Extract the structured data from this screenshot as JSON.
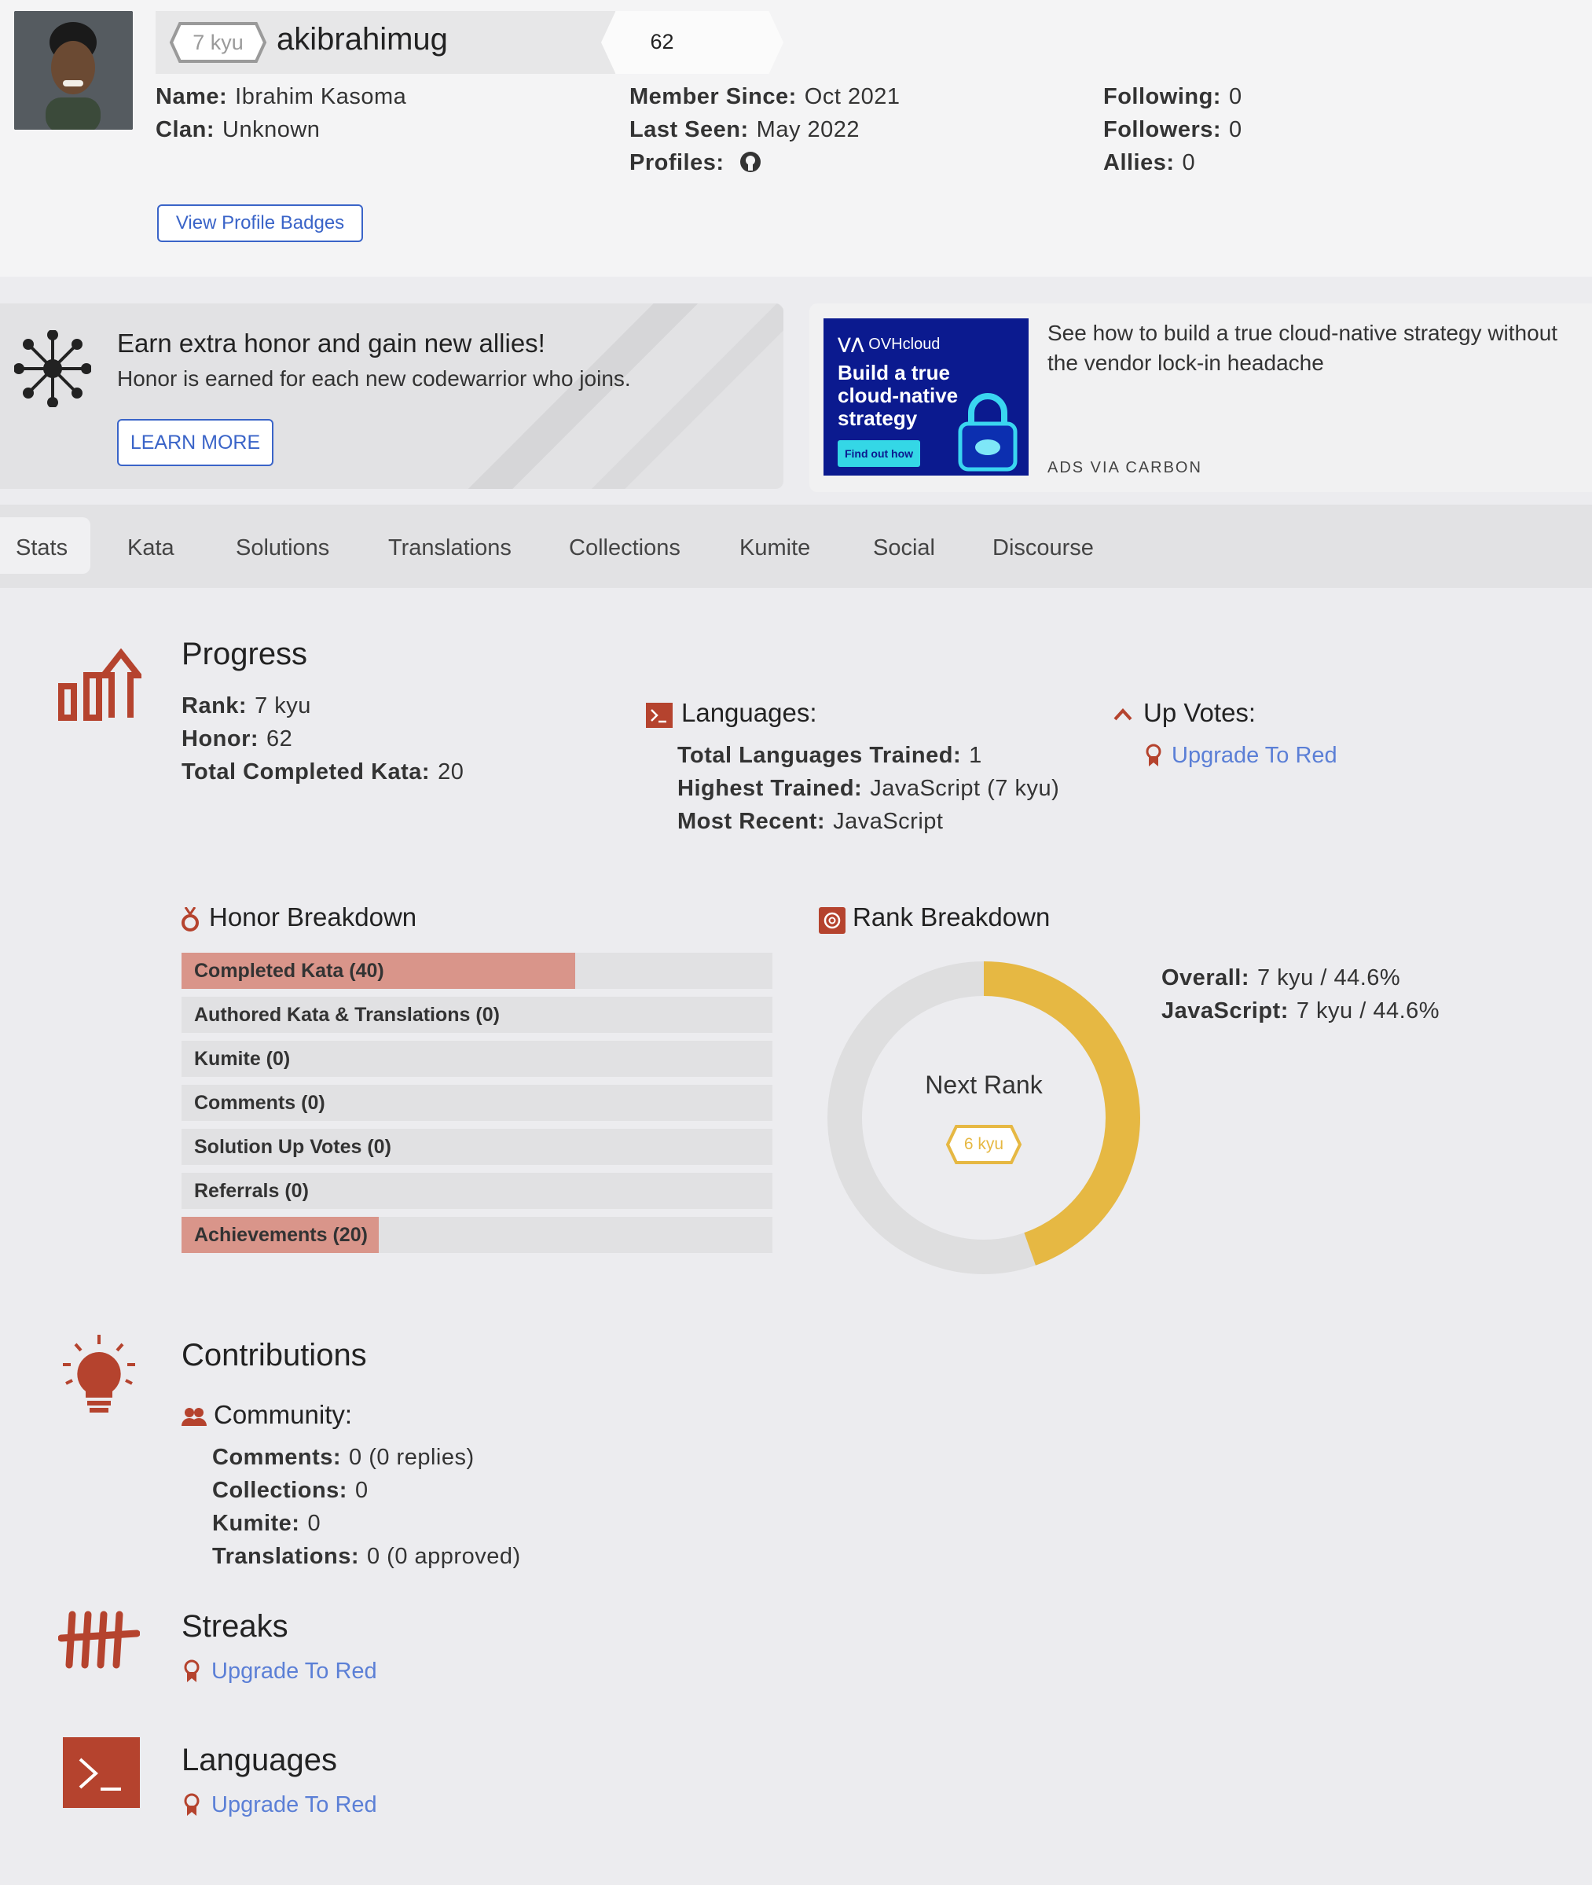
{
  "profile": {
    "rank": "7 kyu",
    "username": "akibrahimug",
    "honor": "62",
    "name_label": "Name:",
    "name": "Ibrahim Kasoma",
    "clan_label": "Clan:",
    "clan": "Unknown",
    "member_since_label": "Member Since:",
    "member_since": "Oct 2021",
    "last_seen_label": "Last Seen:",
    "last_seen": "May 2022",
    "profiles_label": "Profiles:",
    "following_label": "Following:",
    "following": "0",
    "followers_label": "Followers:",
    "followers": "0",
    "allies_label": "Allies:",
    "allies": "0",
    "badges_button": "View Profile Badges"
  },
  "promo": {
    "title": "Earn extra honor and gain new allies!",
    "subtitle": "Honor is earned for each new codewarrior who joins.",
    "button": "LEARN MORE"
  },
  "ad": {
    "brand": "OVHcloud",
    "headline_lines": [
      "Build a true",
      "cloud-native",
      "strategy"
    ],
    "cta": "Find out how",
    "text": "See how to build a true cloud-native strategy without the vendor lock-in headache",
    "footer": "ADS VIA CARBON"
  },
  "tabs": [
    "Stats",
    "Kata",
    "Solutions",
    "Translations",
    "Collections",
    "Kumite",
    "Social",
    "Discourse"
  ],
  "progress": {
    "title": "Progress",
    "rank_label": "Rank:",
    "rank": "7 kyu",
    "honor_label": "Honor:",
    "honor": "62",
    "completed_label": "Total Completed Kata:",
    "completed": "20",
    "languages_title": "Languages:",
    "total_lang_label": "Total Languages Trained:",
    "total_lang": "1",
    "highest_label": "Highest Trained:",
    "highest": "JavaScript (7 kyu)",
    "recent_label": "Most Recent:",
    "recent": "JavaScript",
    "upvotes_title": "Up Votes:",
    "upgrade": "Upgrade To Red"
  },
  "honor_breakdown": {
    "title": "Honor Breakdown",
    "items": [
      {
        "label": "Completed Kata (40)",
        "value": 40
      },
      {
        "label": "Authored Kata & Translations (0)",
        "value": 0
      },
      {
        "label": "Kumite (0)",
        "value": 0
      },
      {
        "label": "Comments (0)",
        "value": 0
      },
      {
        "label": "Solution Up Votes (0)",
        "value": 0
      },
      {
        "label": "Referrals (0)",
        "value": 0
      },
      {
        "label": "Achievements (20)",
        "value": 20
      }
    ],
    "bar_max": 60
  },
  "rank_breakdown": {
    "title": "Rank Breakdown",
    "center_label": "Next Rank",
    "next_rank": "6 kyu",
    "progress_fraction": 0.446,
    "overall_label": "Overall:",
    "overall": "7 kyu / 44.6%",
    "js_label": "JavaScript:",
    "js": "7 kyu / 44.6%",
    "colors": {
      "fill": "#e6b843",
      "track": "#dededf"
    }
  },
  "contributions": {
    "title": "Contributions",
    "community_title": "Community:",
    "comments_label": "Comments:",
    "comments": "0 (0 replies)",
    "collections_label": "Collections:",
    "collections": "0",
    "kumite_label": "Kumite:",
    "kumite": "0",
    "translations_label": "Translations:",
    "translations": "0 (0 approved)"
  },
  "streaks": {
    "title": "Streaks",
    "upgrade": "Upgrade To Red"
  },
  "languages": {
    "title": "Languages",
    "upgrade": "Upgrade To Red"
  },
  "colors": {
    "accent": "#b5432e",
    "link": "#5b7fd6",
    "bar_fill": "#d9958a",
    "donut": "#e6b843"
  }
}
